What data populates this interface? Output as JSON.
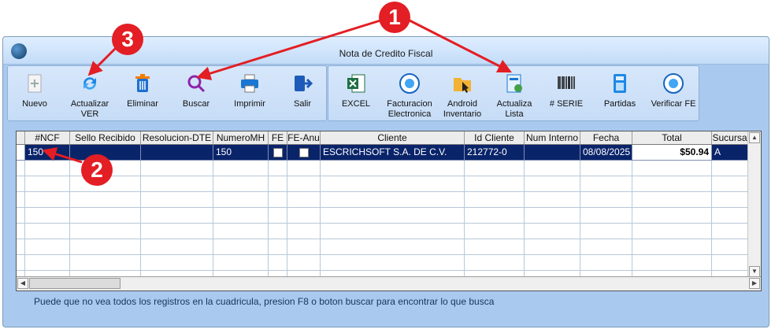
{
  "window": {
    "title": "Nota de Credito Fiscal"
  },
  "toolbar_left": [
    {
      "label": "Nuevo",
      "icon": "new-document-icon"
    },
    {
      "label": "Actualizar VER",
      "icon": "refresh-icon"
    },
    {
      "label": "Eliminar",
      "icon": "trash-icon"
    },
    {
      "label": "Buscar",
      "icon": "magnifier-icon"
    },
    {
      "label": "Imprimir",
      "icon": "printer-icon"
    },
    {
      "label": "Salir",
      "icon": "exit-icon"
    }
  ],
  "toolbar_right": [
    {
      "label": "EXCEL",
      "icon": "excel-icon"
    },
    {
      "label": "Facturacion Electronica",
      "icon": "e-invoice-seal-icon"
    },
    {
      "label": "Android Inventario",
      "icon": "android-inventory-icon"
    },
    {
      "label": "Actualiza Lista",
      "icon": "update-list-icon"
    },
    {
      "label": "# SERIE",
      "icon": "barcode-icon"
    },
    {
      "label": "Partidas",
      "icon": "calculator-icon"
    },
    {
      "label": "Verificar FE",
      "icon": "verify-seal-icon"
    }
  ],
  "grid": {
    "columns": [
      "#NCF",
      "Sello Recibido",
      "Resolucion-DTE",
      "NumeroMH",
      "FE",
      "FE-Anu",
      "Cliente",
      "Id Cliente",
      "Num Interno",
      "Fecha",
      "Total",
      "Sucursa"
    ],
    "rows": [
      {
        "ncf": "150",
        "sello": "",
        "resolucion": "",
        "numeromh": "150",
        "fe": false,
        "fe_anu": false,
        "cliente": "ESCRICHSOFT S.A. DE C.V.",
        "id_cliente": "212772-0",
        "num_interno": "",
        "fecha": "08/08/2025",
        "total": "$50.94",
        "sucursal": "A"
      }
    ]
  },
  "status_text": "Puede que no vea todos los registros en la cuadricula, presion F8 o boton buscar para encontrar lo que busca",
  "callouts": [
    "1",
    "2",
    "3"
  ],
  "colors": {
    "selection": "#0a246a",
    "callout": "#e31e24",
    "window_bg": "#a9c9ee"
  }
}
